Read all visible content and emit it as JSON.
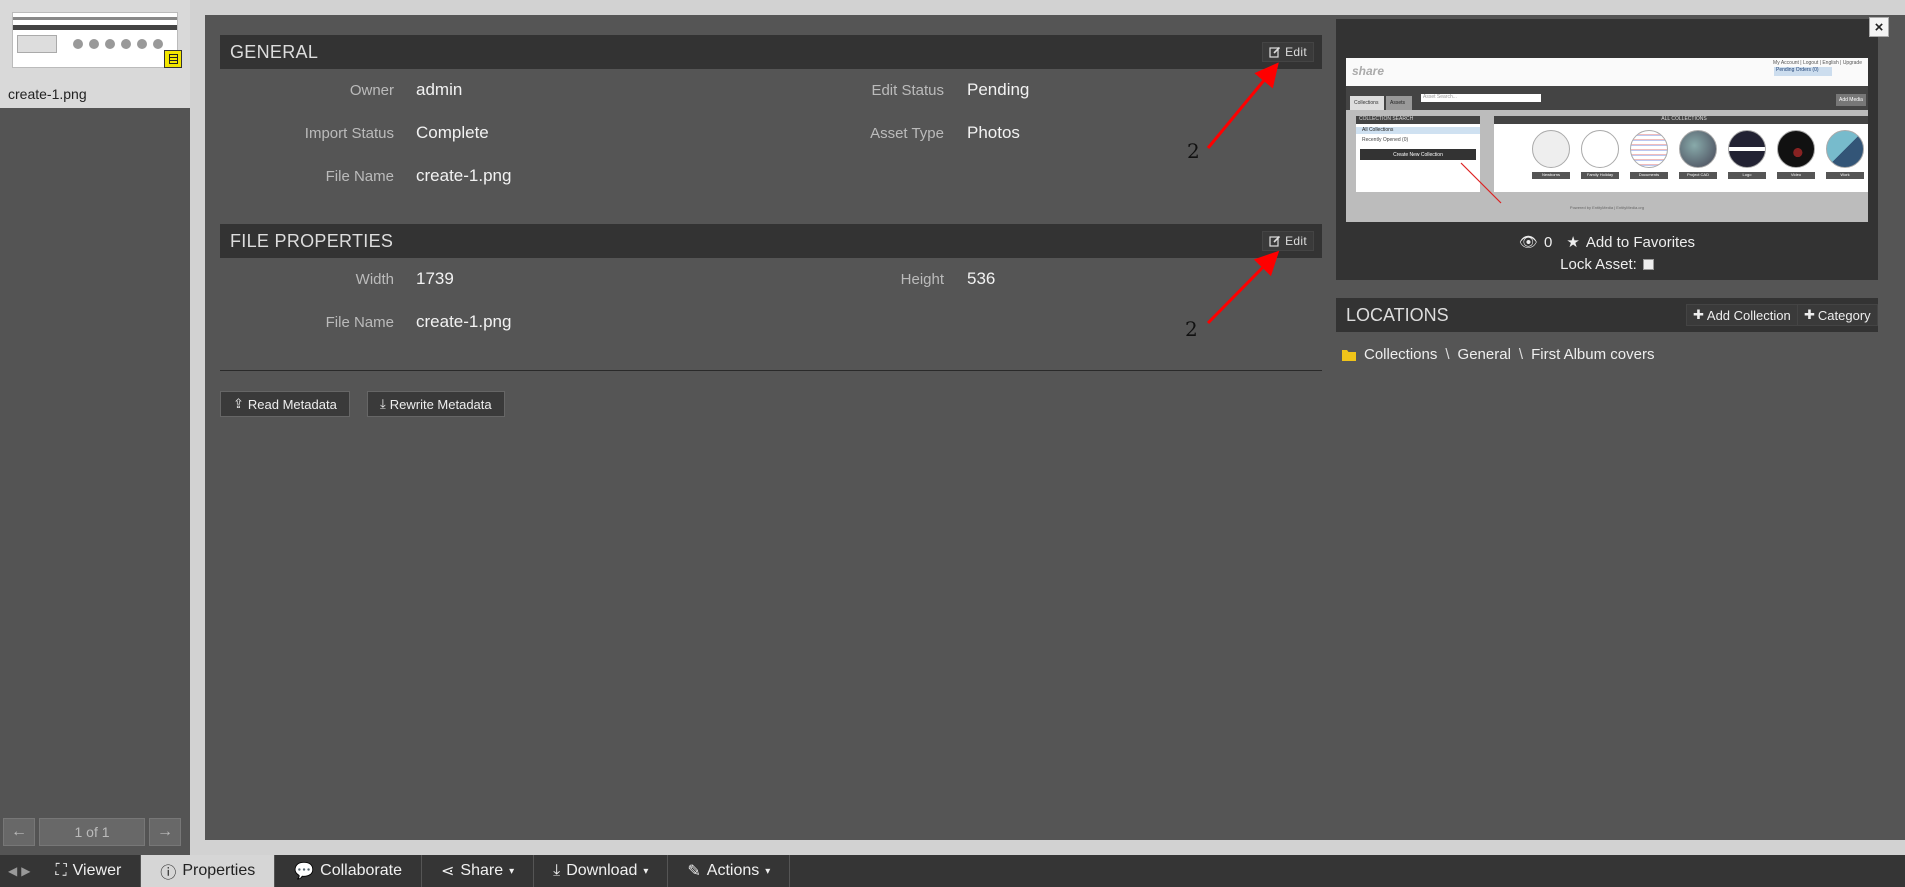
{
  "sidebar": {
    "thumbnail_name": "create-1.png",
    "pager": {
      "prev_label": "←",
      "info": "1 of 1",
      "next_label": "→"
    }
  },
  "general": {
    "title": "GENERAL",
    "edit_label": "Edit",
    "fields": {
      "owner": {
        "label": "Owner",
        "value": "admin"
      },
      "edit_status": {
        "label": "Edit Status",
        "value": "Pending"
      },
      "import_status": {
        "label": "Import Status",
        "value": "Complete"
      },
      "asset_type": {
        "label": "Asset Type",
        "value": "Photos"
      },
      "file_name": {
        "label": "File Name",
        "value": "create-1.png"
      }
    },
    "annotation": "2"
  },
  "file_properties": {
    "title": "FILE PROPERTIES",
    "edit_label": "Edit",
    "fields": {
      "width": {
        "label": "Width",
        "value": "1739"
      },
      "height": {
        "label": "Height",
        "value": "536"
      },
      "file_name": {
        "label": "File Name",
        "value": "create-1.png"
      }
    },
    "annotation": "2"
  },
  "metadata_actions": {
    "read_label": "Read Metadata",
    "rewrite_label": "Rewrite Metadata"
  },
  "preview": {
    "views": "0",
    "favorites_label": "Add to Favorites",
    "lock_label": "Lock Asset:",
    "screenshot": {
      "logo": "share",
      "top_links": "My Account | Logout | English | Upgrade",
      "pending": "Pending Orders (0)",
      "tab_collections": "Collections",
      "tab_assets": "Assets",
      "search_placeholder": "Asset Search...",
      "add_media": "Add Media",
      "collection_search": "COLLECTION SEARCH",
      "all_collections": "All Collections",
      "recently_opened": "Recently Opened (0)",
      "create_new": "Create New Collection",
      "all_collections_header": "ALL COLLECTIONS",
      "circle_labels": [
        "Newborns",
        "Family Holiday",
        "Documents",
        "Project CAD",
        "Logo",
        "Video",
        "Work"
      ],
      "footer": "Powered by EntityMedia | EntityMedia.org"
    }
  },
  "locations": {
    "title": "LOCATIONS",
    "add_collection_label": "Add Collection",
    "category_label": "Category",
    "path": [
      "Collections",
      "General",
      "First Album covers"
    ],
    "separator": "\\"
  },
  "close_label": "×",
  "toolbar": {
    "viewer": "Viewer",
    "properties": "Properties",
    "collaborate": "Collaborate",
    "share": "Share",
    "download": "Download",
    "actions": "Actions"
  },
  "colors": {
    "annotation_arrow": "#ff0000",
    "panel_bg": "#555555",
    "header_bg": "#333333",
    "folder_icon": "#f0c419"
  }
}
